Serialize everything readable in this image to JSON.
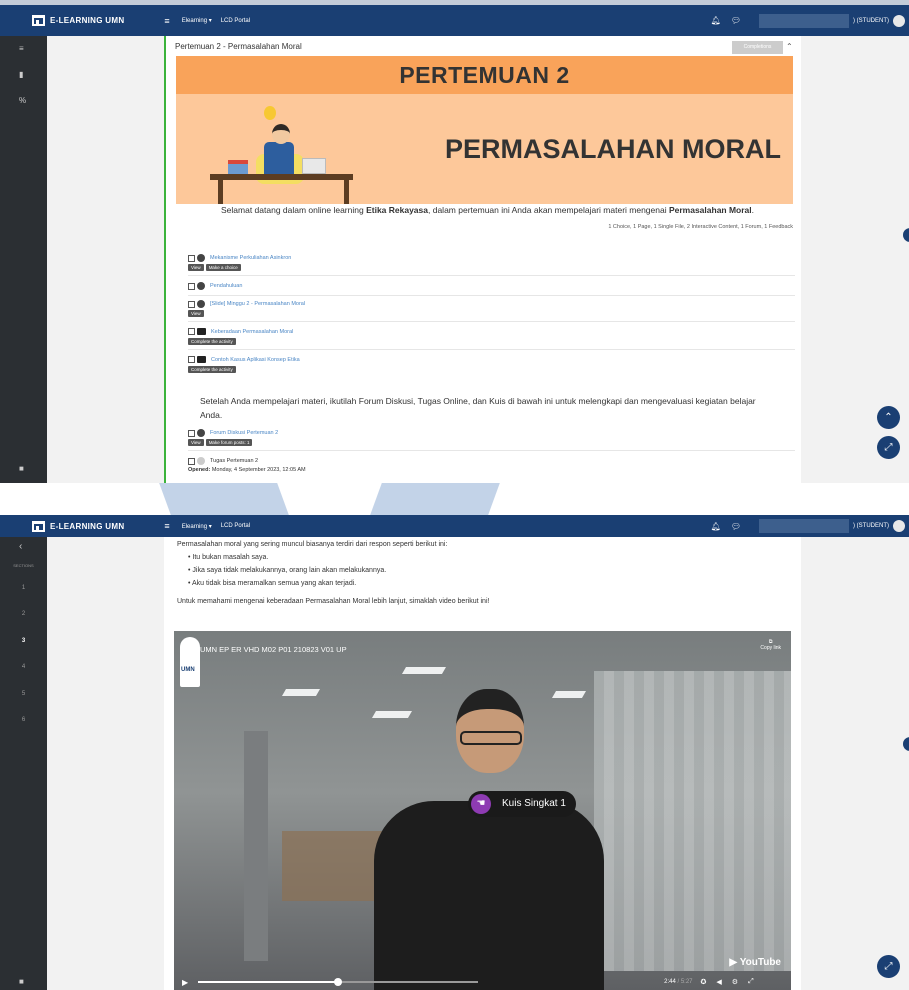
{
  "app": {
    "brand": "E-LEARNING UMN",
    "menu_icon": "hamburger-icon",
    "nav": [
      {
        "label": "Elearning ▾"
      },
      {
        "label": "LCD Portal"
      }
    ],
    "user_role": ") (STUDENT)",
    "colors": {
      "navbar": "#1a3f73",
      "sidebar": "#2b2f33",
      "accent": "#3bb33b",
      "link": "#4a86c5"
    }
  },
  "screen1": {
    "section_title": "Pertemuan 2 - Permasalahan Moral",
    "completions_label": "Completions",
    "banner": {
      "line1": "PERTEMUAN 2",
      "line2": "PERMASALAHAN MORAL"
    },
    "welcome_pre": "Selamat datang dalam online learning ",
    "welcome_course": "Etika Rekayasa",
    "welcome_mid": ", dalam pertemuan ini Anda akan mempelajari materi mengenai ",
    "welcome_topic": "Permasalahan Moral",
    "welcome_end": ".",
    "summary": "1 Choice, 1 Page, 1 Single File, 2 Interactive Content, 1 Forum, 1 Feedback",
    "activities": [
      {
        "name": "Mekanisme Perkuliahan Asinkron",
        "icon": "choice-icon",
        "tags": [
          "View",
          "Make a choice"
        ]
      },
      {
        "name": "Pendahuluan",
        "icon": "page-icon",
        "tags": []
      },
      {
        "name": "[Slide] Minggu 2 - Permasalahan Moral",
        "icon": "file-icon",
        "tags": [
          "View"
        ]
      },
      {
        "name": "Keberadaan Permasalahan Moral",
        "icon": "h5p-icon",
        "tags": [
          "Complete the activity"
        ]
      },
      {
        "name": "Contoh Kasus Aplikasi Konsep Etika",
        "icon": "h5p-icon",
        "tags": [
          "Complete the activity"
        ]
      },
      {
        "name": "Forum Diskusi Pertemuan 2",
        "icon": "forum-icon",
        "tags": [
          "View",
          "Make forum posts: 1"
        ]
      },
      {
        "name": "Tugas Pertemuan 2",
        "icon": "assignment-icon",
        "tags": []
      }
    ],
    "paragraph": "Setelah Anda mempelajari materi, ikutilah Forum Diskusi, Tugas Online, dan Kuis di bawah ini untuk melengkapi dan mengevaluasi kegiatan belajar Anda.",
    "opened_label": "Opened:",
    "opened_value": " Monday, 4 September 2023, 12:05 AM"
  },
  "screen2": {
    "sections_label": "SECTIONS",
    "sections": [
      "1",
      "2",
      "3",
      "4",
      "5",
      "6"
    ],
    "active_section": "3",
    "intro": "Permasalahan moral yang sering muncul biasanya terdiri dari respon seperti berikut ini:",
    "bullets": [
      "Itu bukan masalah saya.",
      "Jika saya tidak melakukannya, orang lain akan melakukannya.",
      "Aku tidak bisa meramalkan semua yang akan terjadi."
    ],
    "video_intro": "Untuk memahami mengenai keberadaan Permasalahan Moral lebih lanjut, simaklah video berikut ini!",
    "video": {
      "title": "UMN EP ER VHD M02 P01 210823 V01 UP",
      "logo_text": "UMN",
      "copy_link": "Copy link",
      "popup": "Kuis Singkat 1",
      "brand": "YouTube",
      "time_current": "2:44",
      "time_total": " / 5:27",
      "progress": 0.5
    }
  }
}
